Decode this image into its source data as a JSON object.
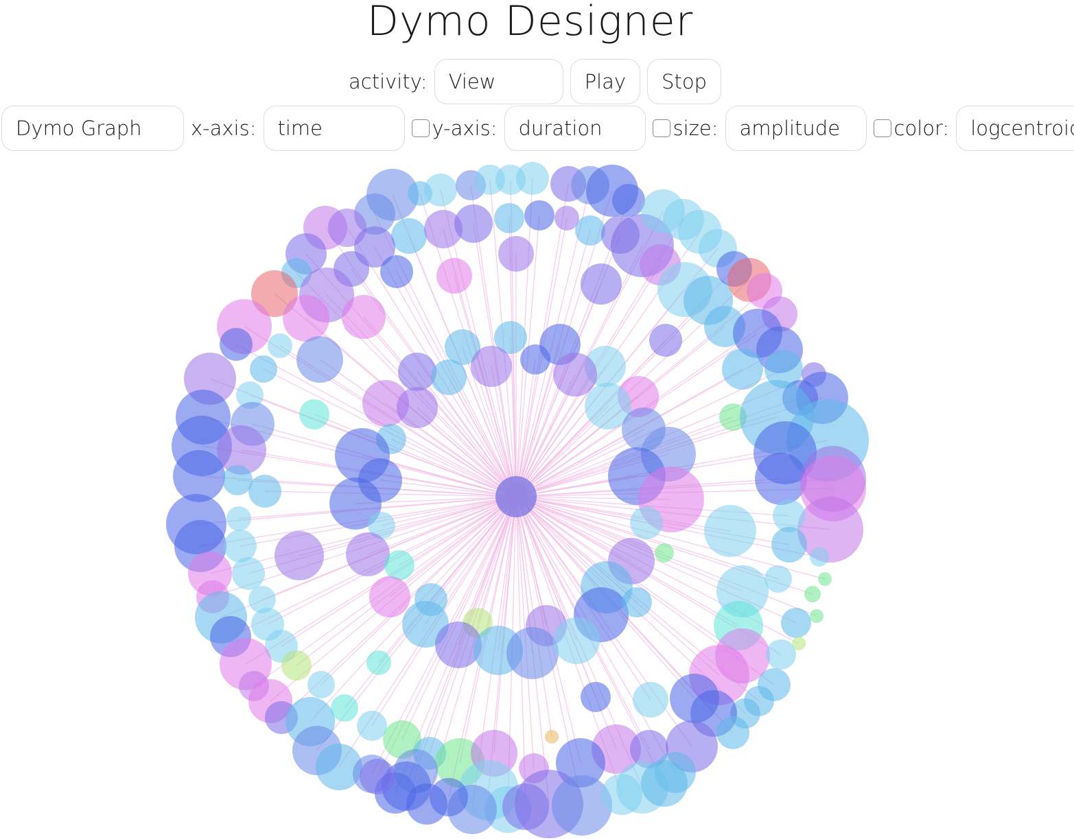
{
  "app": {
    "title": "Dymo Designer"
  },
  "toolbar": {
    "activity_label": "activity:",
    "activity_value": "View",
    "play_label": "Play",
    "stop_label": "Stop"
  },
  "controls": {
    "view_value": "Dymo Graph",
    "x_axis_label": "x-axis:",
    "x_axis_value": "time",
    "y_axis_label": "y-axis:",
    "y_axis_value": "duration",
    "y_axis_checked": false,
    "size_label": "size:",
    "size_value": "amplitude",
    "size_checked": false,
    "color_label": "color:",
    "color_value": "logcentroid",
    "color_checked": false
  },
  "colors": {
    "edge": "#f3b8e6",
    "hub": "#6e6fe0",
    "palette": [
      "#7fd0ee",
      "#5fb8ea",
      "#6a8ae8",
      "#4a66e6",
      "#7d6ee8",
      "#9a72e8",
      "#c277ea",
      "#e07ae8",
      "#e86ea8",
      "#e8666e",
      "#5ee6d8",
      "#6fe68e",
      "#b4e67a",
      "#e8b45a"
    ]
  }
}
